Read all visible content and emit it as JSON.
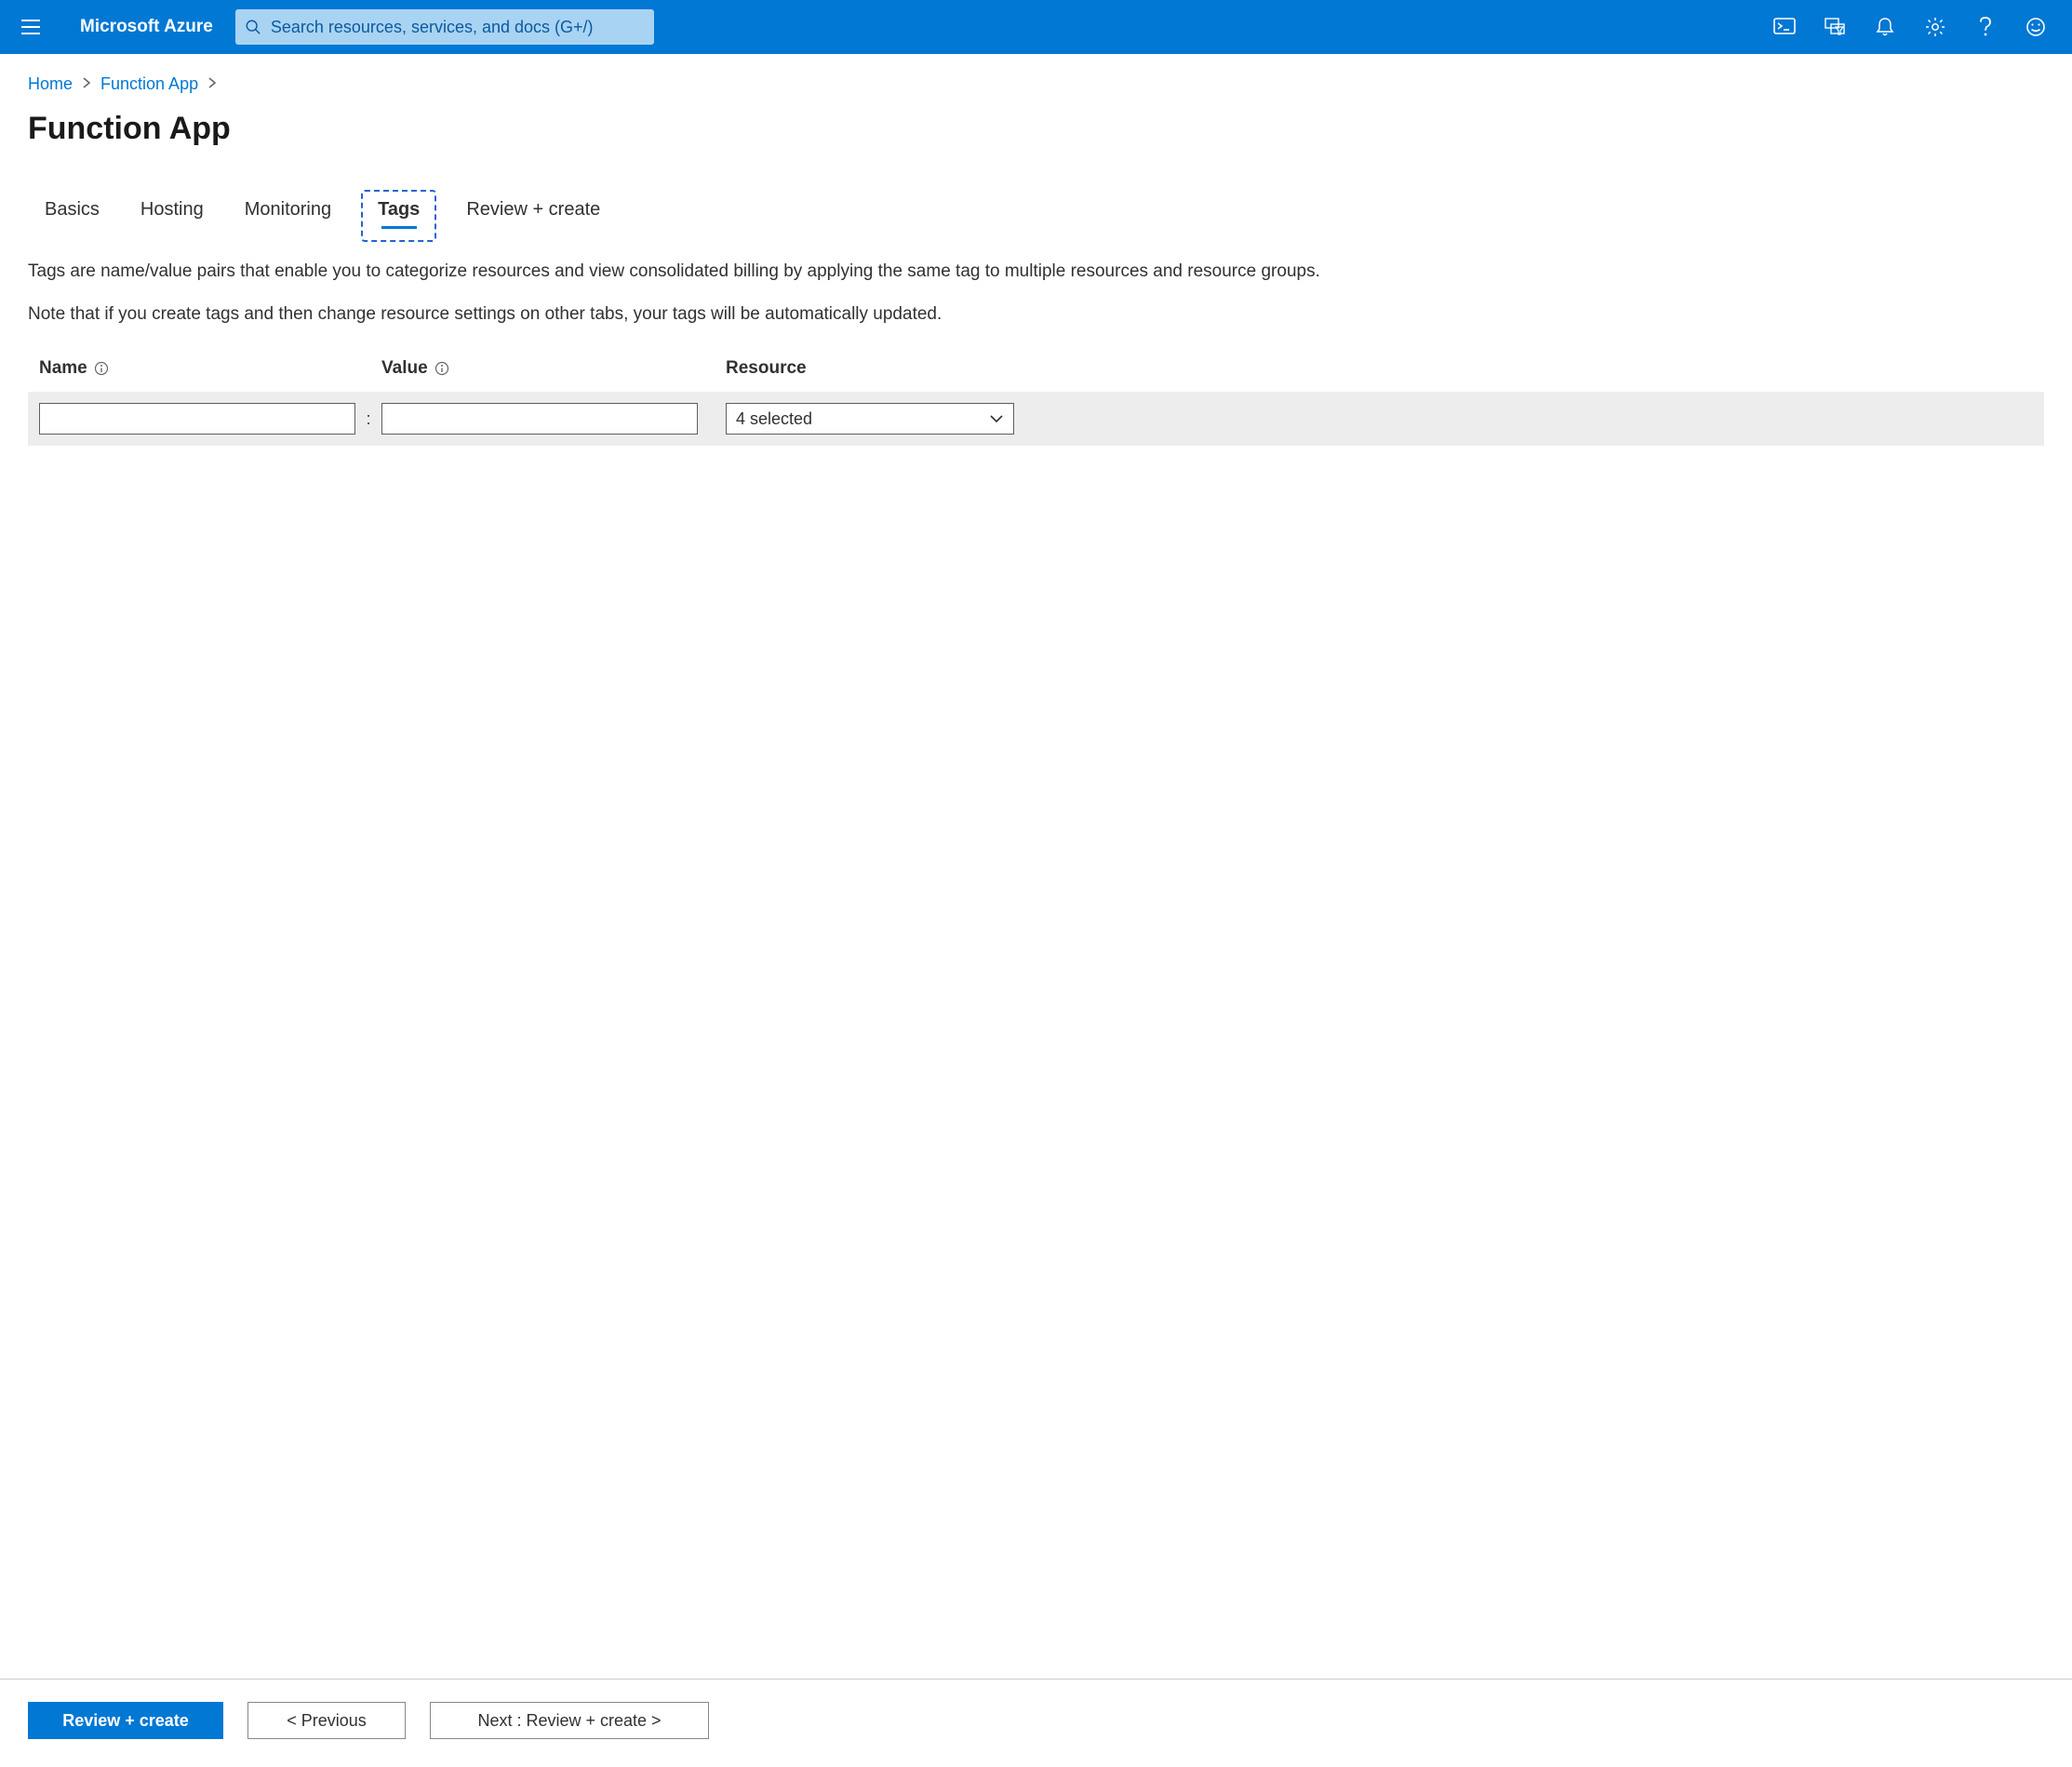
{
  "header": {
    "brand": "Microsoft Azure",
    "search_placeholder": "Search resources, services, and docs (G+/)"
  },
  "breadcrumb": {
    "items": [
      "Home",
      "Function App"
    ]
  },
  "page": {
    "title": "Function App"
  },
  "tabs": {
    "items": [
      {
        "label": "Basics",
        "active": false
      },
      {
        "label": "Hosting",
        "active": false
      },
      {
        "label": "Monitoring",
        "active": false
      },
      {
        "label": "Tags",
        "active": true
      },
      {
        "label": "Review + create",
        "active": false
      }
    ]
  },
  "tags_page": {
    "desc1": "Tags are name/value pairs that enable you to categorize resources and view consolidated billing by applying the same tag to multiple resources and resource groups.",
    "desc2": "Note that if you create tags and then change resource settings on other tabs, your tags will be automatically updated.",
    "columns": {
      "name": "Name",
      "value": "Value",
      "resource": "Resource"
    },
    "row": {
      "name_value": "",
      "value_value": "",
      "resource_selected": "4 selected"
    }
  },
  "footer": {
    "review_create": "Review + create",
    "previous": "< Previous",
    "next": "Next : Review + create >"
  }
}
